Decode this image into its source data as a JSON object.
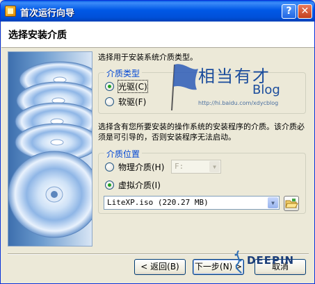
{
  "window": {
    "title": "首次运行向导",
    "help_glyph": "?",
    "close_glyph": "✕"
  },
  "header": {
    "title": "选择安装介质"
  },
  "main": {
    "intro": "选择用于安装系统介质类型。",
    "media_type": {
      "legend": "介质类型",
      "options": [
        {
          "label": "光驱(C)",
          "checked": true
        },
        {
          "label": "软驱(F)",
          "checked": false
        }
      ]
    },
    "description": "选择含有您所要安装的操作系统的安装程序的介质。该介质必须是可引导的，否则安装程序无法启动。",
    "media_location": {
      "legend": "介质位置",
      "physical": {
        "label": "物理介质(H)",
        "checked": false,
        "drive_value": "F:"
      },
      "virtual": {
        "label": "虚拟介质(I)",
        "checked": true
      },
      "image_value": "LiteXP.iso (220.27 MB)"
    }
  },
  "buttons": {
    "back": "< 返回(B)",
    "next": "下一步(N) >",
    "cancel": "取消"
  },
  "watermarks": {
    "blog_cn": "相当有才",
    "blog_word": "Blog",
    "blog_url": "http://hi.baidu.com/xdycblog",
    "deepin": "DEEPIN"
  },
  "icons": {
    "app": "wizard-app-icon",
    "art": "cd-disc-stack",
    "browse": "folder-open-icon"
  },
  "colors": {
    "titlebar": "#0058e6",
    "window_bg": "#ece9d8",
    "group_legend": "#0046d5",
    "radio_check": "#21a121"
  }
}
